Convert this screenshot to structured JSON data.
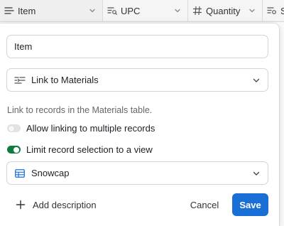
{
  "grid": {
    "columns": [
      {
        "label": "Item",
        "icon": "primary-field-icon"
      },
      {
        "label": "UPC",
        "icon": "lookup-text-icon"
      },
      {
        "label": "Quantity",
        "icon": "number-icon"
      },
      {
        "label": "S",
        "icon": "lookup-text-icon"
      }
    ]
  },
  "panel": {
    "field_name": "Item",
    "field_type": {
      "label": "Link to Materials",
      "icon": "link-records-icon"
    },
    "help_text": "Link to records in the Materials table.",
    "toggles": [
      {
        "label": "Allow linking to multiple records",
        "on": false
      },
      {
        "label": "Limit record selection to a view",
        "on": true
      }
    ],
    "view_select": {
      "label": "Snowcap",
      "icon": "grid-view-icon"
    },
    "footer": {
      "add_description": "Add description",
      "cancel": "Cancel",
      "save": "Save"
    }
  },
  "colors": {
    "save_button": "#1a6fd6",
    "toggle_on": "#0f7b3f",
    "view_icon": "#1a6fd6"
  }
}
